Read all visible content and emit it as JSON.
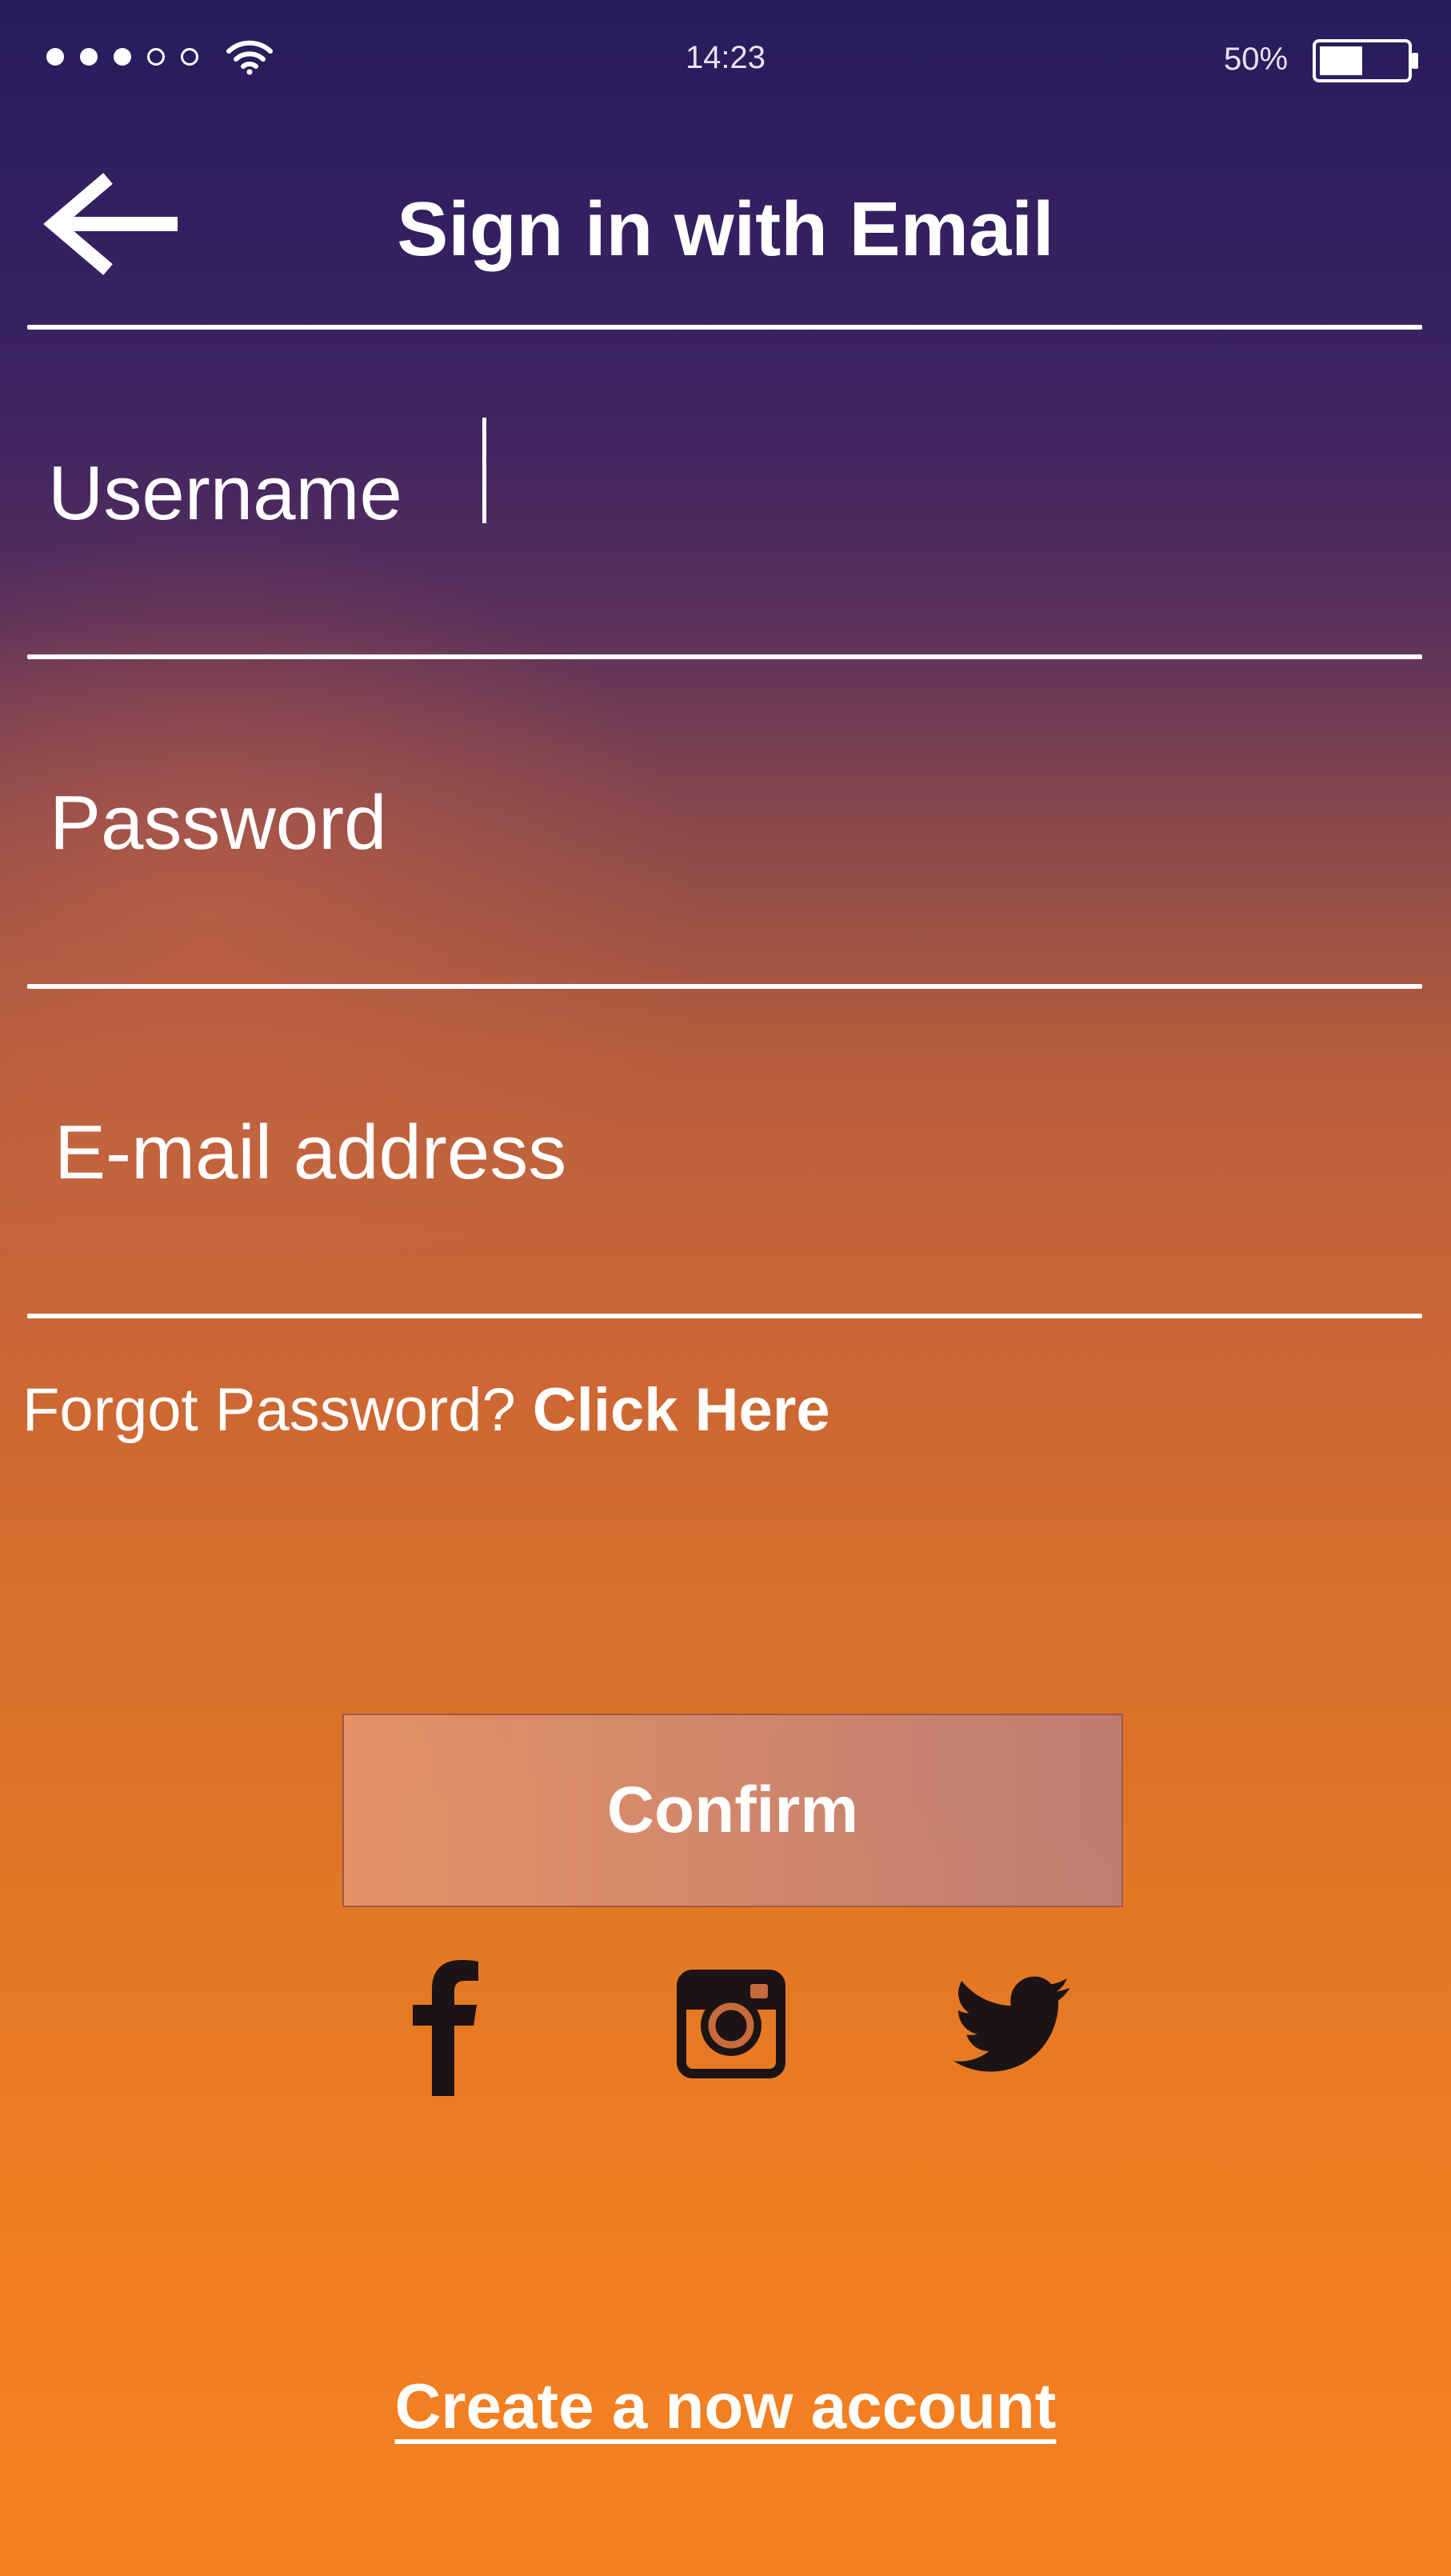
{
  "status_bar": {
    "time": "14:23",
    "battery_percent": "50%",
    "battery_level": 0.5,
    "signal_bars_filled": 3,
    "signal_bars_total": 5
  },
  "header": {
    "title": "Sign in with Email",
    "back_icon": "back-arrow-icon"
  },
  "form": {
    "username_label": "Username",
    "password_label": "Password",
    "email_label": "E-mail address"
  },
  "forgot": {
    "prefix": "Forgot Password?",
    "link": "Click Here"
  },
  "confirm_button_label": "Confirm",
  "social": {
    "icons": [
      "facebook-icon",
      "instagram-icon",
      "twitter-icon"
    ]
  },
  "footer": {
    "create_account_label": "Create a now account"
  },
  "colors": {
    "top": "#271c5c",
    "bottom": "#f58020",
    "social_icon": "#1c1414"
  }
}
